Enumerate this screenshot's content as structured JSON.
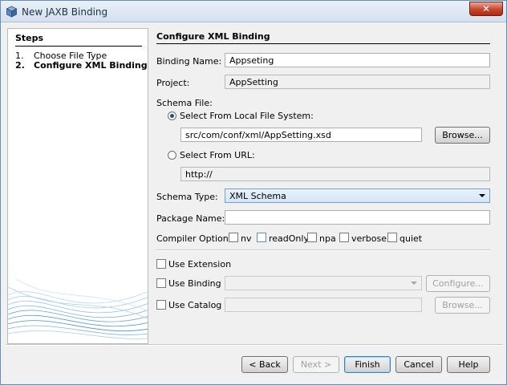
{
  "window": {
    "title": "New JAXB Binding"
  },
  "steps": {
    "title": "Steps",
    "items": [
      {
        "num": "1.",
        "label": "Choose File Type"
      },
      {
        "num": "2.",
        "label": "Configure XML Binding"
      }
    ]
  },
  "main": {
    "title": "Configure XML Binding",
    "binding_name": {
      "label": "Binding Name:",
      "value": "Appseting"
    },
    "project": {
      "label": "Project:",
      "value": "AppSetting"
    },
    "schema_file": {
      "label": "Schema File:",
      "local": {
        "label": "Select From Local File System:",
        "value": "src/com/conf/xml/AppSetting.xsd",
        "browse": "Browse..."
      },
      "url": {
        "label": "Select From URL:",
        "value": "http://"
      }
    },
    "schema_type": {
      "label": "Schema Type:",
      "value": "XML Schema"
    },
    "package_name": {
      "label": "Package Name:",
      "value": ""
    },
    "compiler_options": {
      "label": "Compiler Options:",
      "options": [
        "nv",
        "readOnly",
        "npa",
        "verbose",
        "quiet"
      ]
    },
    "use_extension": "Use Extension",
    "use_binding_file": {
      "label": "Use Binding File",
      "button": "Configure..."
    },
    "use_catalog_file": {
      "label": "Use Catalog File",
      "button": "Browse..."
    }
  },
  "buttons": {
    "back": "< Back",
    "next": "Next >",
    "finish": "Finish",
    "cancel": "Cancel",
    "help": "Help"
  },
  "colors": {
    "accent": "#3c7fb1",
    "title_bar": "#d4e0ee",
    "close": "#c7442b"
  }
}
